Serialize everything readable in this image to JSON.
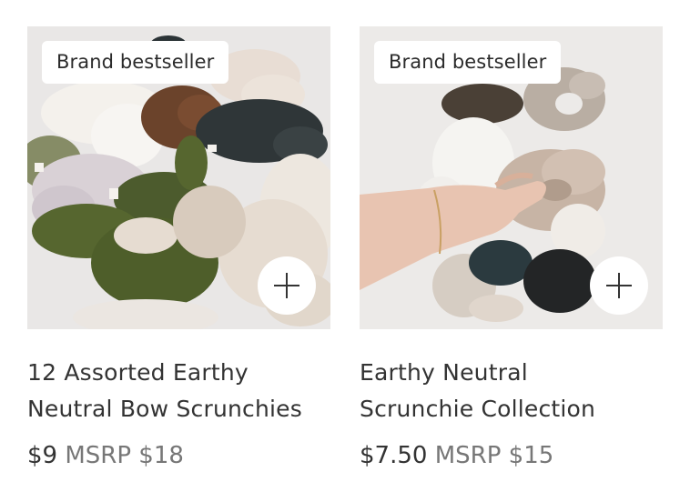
{
  "products": [
    {
      "badge": "Brand bestseller",
      "title_line1": "12 Assorted Earthy",
      "title_line2": "Neutral Bow Scrunchies",
      "price": "$9",
      "msrp": "MSRP $18",
      "image_desc_icon": "scrunchie-photo",
      "add_icon": "plus-icon"
    },
    {
      "badge": "Brand bestseller",
      "title_line1": "Earthy Neutral",
      "title_line2": "Scrunchie Collection",
      "price": "$7.50",
      "msrp": "MSRP $15",
      "image_desc_icon": "scrunchie-photo",
      "add_icon": "plus-icon"
    }
  ],
  "colors": {
    "text_primary": "#333333",
    "text_secondary": "#777777",
    "badge_bg": "#ffffff"
  }
}
